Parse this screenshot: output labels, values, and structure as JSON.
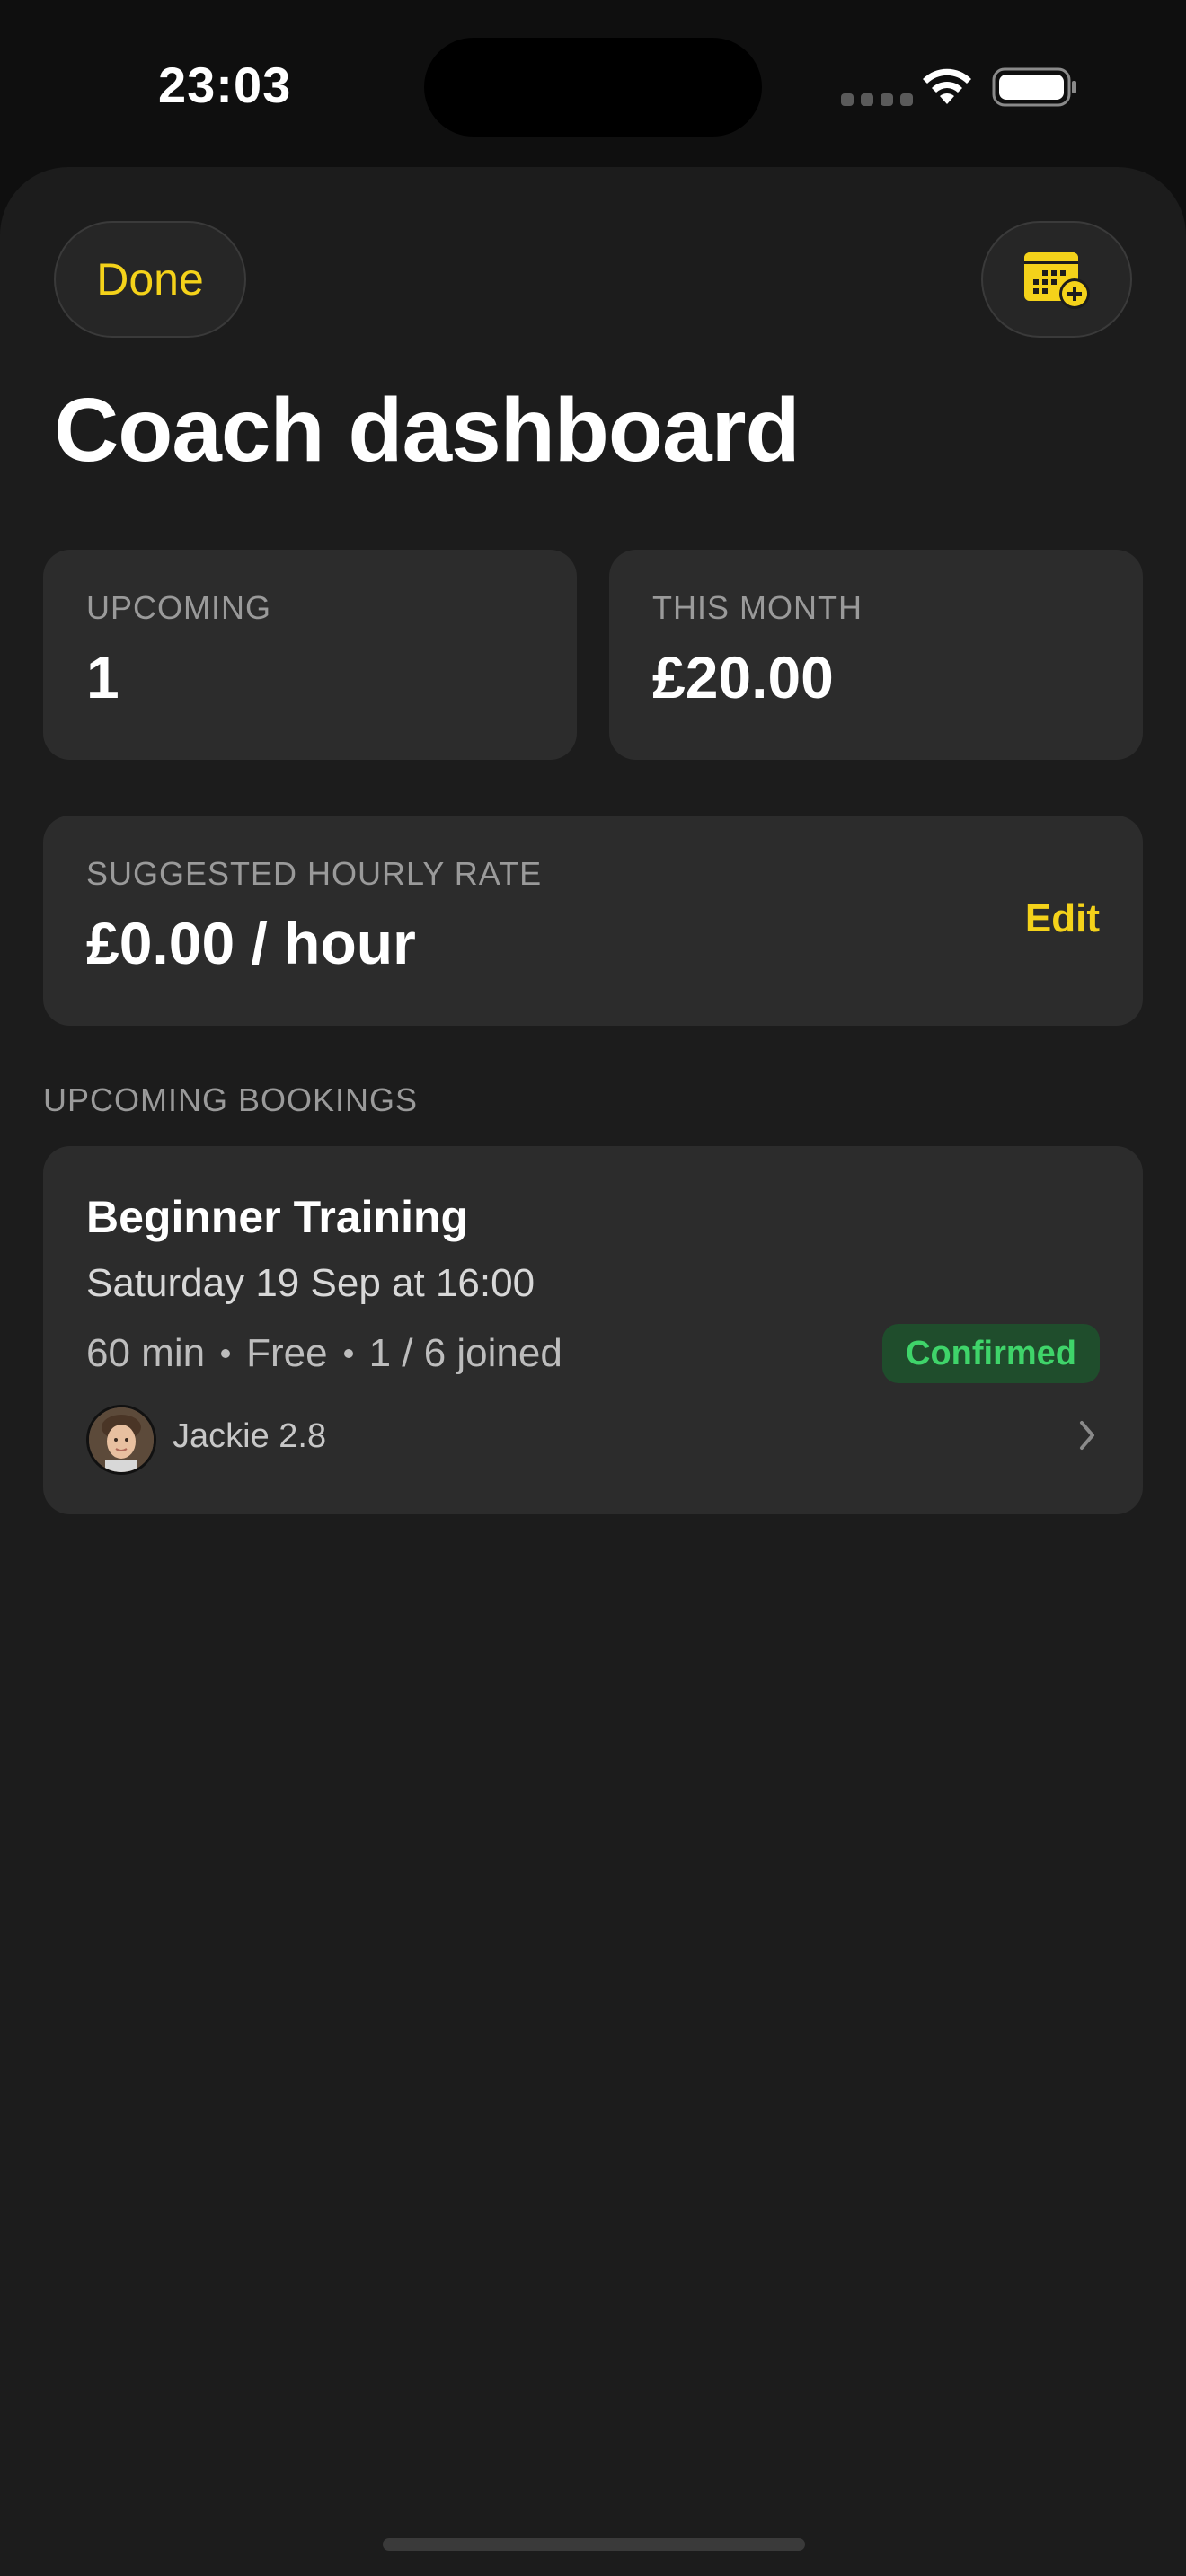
{
  "status_bar": {
    "time": "23:03"
  },
  "header": {
    "done_label": "Done",
    "calendar_button_icon": "calendar-add-icon",
    "title": "Coach dashboard"
  },
  "stats": {
    "upcoming": {
      "label": "UPCOMING",
      "value": "1"
    },
    "this_month": {
      "label": "THIS MONTH",
      "value": "£20.00"
    }
  },
  "rate": {
    "label": "SUGGESTED HOURLY RATE",
    "value": "£0.00 / hour",
    "edit_label": "Edit"
  },
  "bookings": {
    "section_title": "UPCOMING BOOKINGS",
    "items": [
      {
        "title": "Beginner Training",
        "date": "Saturday 19 Sep at 16:00",
        "duration": "60 min",
        "price": "Free",
        "joined": "1 / 6 joined",
        "status": "Confirmed",
        "participant": "Jackie 2.8"
      }
    ]
  },
  "colors": {
    "accent": "#f4d21a",
    "confirmed_text": "#3fd46a",
    "confirmed_bg": "#1f4d2c",
    "card_bg": "#2c2c2c",
    "sheet_bg": "#1c1c1c"
  }
}
